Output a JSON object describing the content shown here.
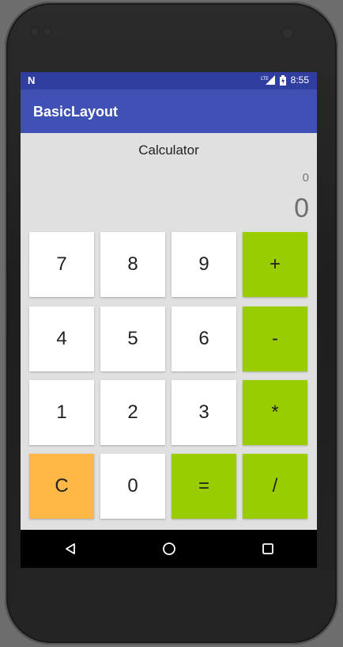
{
  "status_bar": {
    "carrier_icon": "n-notification-icon",
    "network_label": "LTE",
    "time": "8:55"
  },
  "app_bar": {
    "title": "BasicLayout"
  },
  "calculator": {
    "label": "Calculator",
    "expression": "0",
    "result": "0",
    "keys": [
      {
        "label": "7",
        "kind": "digit"
      },
      {
        "label": "8",
        "kind": "digit"
      },
      {
        "label": "9",
        "kind": "digit"
      },
      {
        "label": "+",
        "kind": "op"
      },
      {
        "label": "4",
        "kind": "digit"
      },
      {
        "label": "5",
        "kind": "digit"
      },
      {
        "label": "6",
        "kind": "digit"
      },
      {
        "label": "-",
        "kind": "op"
      },
      {
        "label": "1",
        "kind": "digit"
      },
      {
        "label": "2",
        "kind": "digit"
      },
      {
        "label": "3",
        "kind": "digit"
      },
      {
        "label": "*",
        "kind": "op"
      },
      {
        "label": "C",
        "kind": "clear"
      },
      {
        "label": "0",
        "kind": "digit"
      },
      {
        "label": "=",
        "kind": "op"
      },
      {
        "label": "/",
        "kind": "op"
      }
    ]
  },
  "colors": {
    "primary_dark": "#303f9f",
    "primary": "#3f51b5",
    "operator_key": "#9acd00",
    "clear_key": "#ffb746",
    "digit_key": "#ffffff",
    "background": "#dfe0df"
  },
  "nav_bar": {
    "back_icon": "back-triangle-icon",
    "home_icon": "home-circle-icon",
    "recents_icon": "recents-square-icon"
  }
}
